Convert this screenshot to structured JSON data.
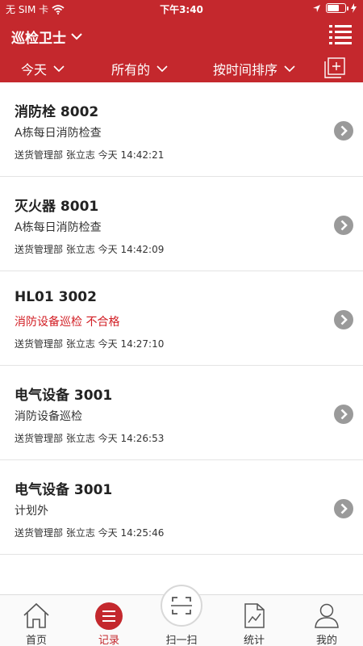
{
  "status_bar": {
    "carrier": "无 SIM 卡",
    "time": "下午3:40",
    "battery_level": 0.65
  },
  "nav": {
    "title": "巡检卫士",
    "title_icon": "chevron-down-icon",
    "right_icon": "list-menu-icon"
  },
  "filters": {
    "date": "今天",
    "scope": "所有的",
    "sort": "按时间排序",
    "add_icon": "add-square-icon"
  },
  "records": [
    {
      "title": "消防栓 8002",
      "subtitle": "A栋每日消防检查",
      "subtitle_alert": false,
      "meta": "送货管理部 张立志 今天 14:42:21"
    },
    {
      "title": "灭火器 8001",
      "subtitle": "A栋每日消防检查",
      "subtitle_alert": false,
      "meta": "送货管理部 张立志 今天 14:42:09"
    },
    {
      "title": "HL01 3002",
      "subtitle": "消防设备巡检 不合格",
      "subtitle_alert": true,
      "meta": "送货管理部 张立志 今天 14:27:10"
    },
    {
      "title": "电气设备 3001",
      "subtitle": "消防设备巡检",
      "subtitle_alert": false,
      "meta": "送货管理部 张立志 今天 14:26:53"
    },
    {
      "title": "电气设备 3001",
      "subtitle": "计划外",
      "subtitle_alert": false,
      "meta": "送货管理部 张立志 今天 14:25:46"
    }
  ],
  "tabs": [
    {
      "label": "首页",
      "icon": "home-icon",
      "active": false
    },
    {
      "label": "记录",
      "icon": "records-icon",
      "active": true
    },
    {
      "label": "扫一扫",
      "icon": "scan-icon",
      "active": false
    },
    {
      "label": "统计",
      "icon": "chart-icon",
      "active": false
    },
    {
      "label": "我的",
      "icon": "user-icon",
      "active": false
    }
  ],
  "colors": {
    "brand": "#c4282d",
    "alert_text": "#d21e24",
    "tab_inactive": "#333333"
  }
}
